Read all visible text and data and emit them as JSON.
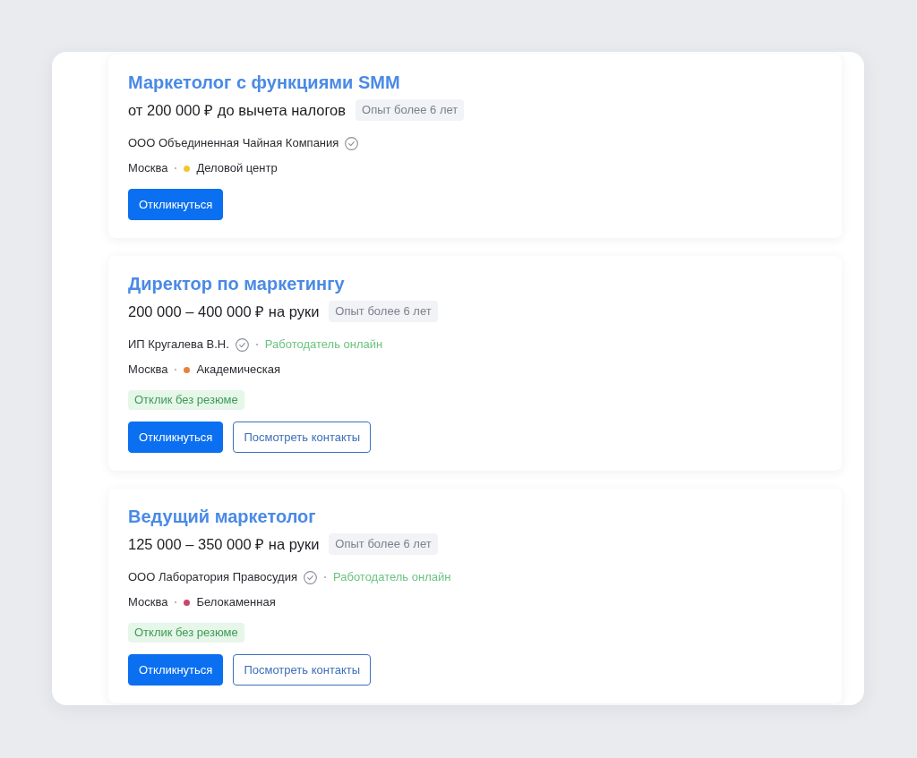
{
  "vacancies": [
    {
      "title": "Маркетолог с функциями SMM",
      "salary": "от 200 000 ₽ до вычета налогов",
      "experience": "Опыт более 6 лет",
      "company": "ООО Объединенная Чайная Компания",
      "verified": true,
      "city": "Москва",
      "metro": {
        "name": "Деловой центр",
        "color": "#f2c62f"
      },
      "buttons": [
        {
          "label": "Откликнуться",
          "kind": "primary"
        }
      ]
    },
    {
      "title": "Директор по маркетингу",
      "salary": "200 000 – 400 000 ₽ на руки",
      "experience": "Опыт более 6 лет",
      "company": "ИП Кругалева В.Н.",
      "verified": true,
      "online_status": "Работодатель онлайн",
      "city": "Москва",
      "metro": {
        "name": "Академическая",
        "color": "#e8813f"
      },
      "tags": [
        "Отклик без резюме"
      ],
      "buttons": [
        {
          "label": "Откликнуться",
          "kind": "primary"
        },
        {
          "label": "Посмотреть контакты",
          "kind": "outline"
        }
      ]
    },
    {
      "title": "Ведущий маркетолог",
      "salary": "125 000 – 350 000 ₽ на руки",
      "experience": "Опыт более 6 лет",
      "company": "ООО Лаборатория Правосудия",
      "verified": true,
      "online_status": "Работодатель онлайн",
      "city": "Москва",
      "metro": {
        "name": "Белокаменная",
        "color": "#c9466c"
      },
      "tags": [
        "Отклик без резюме"
      ],
      "buttons": [
        {
          "label": "Откликнуться",
          "kind": "primary"
        },
        {
          "label": "Посмотреть контакты",
          "kind": "outline"
        }
      ]
    }
  ]
}
